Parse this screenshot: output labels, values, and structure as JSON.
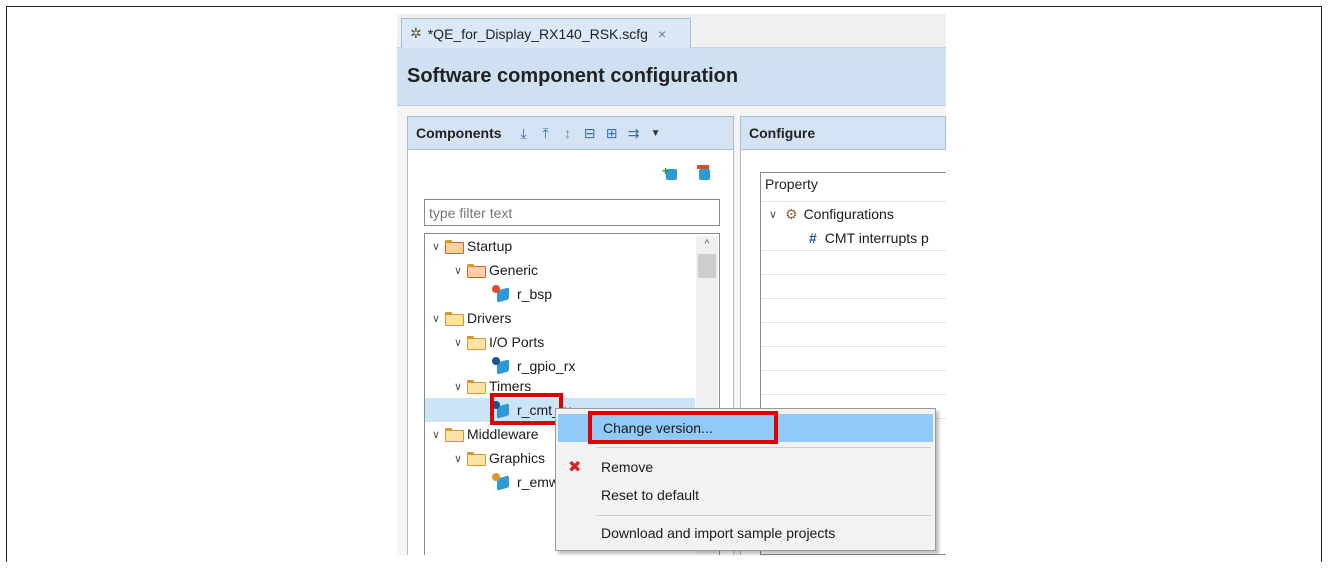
{
  "tab": {
    "title": "*QE_for_Display_RX140_RSK.scfg",
    "close": "×"
  },
  "editor": {
    "title": "Software component configuration"
  },
  "components_panel": {
    "title": "Components",
    "filter_placeholder": "type filter text",
    "tree": [
      {
        "label": "Startup"
      },
      {
        "label": "Generic"
      },
      {
        "label": "r_bsp"
      },
      {
        "label": "Drivers"
      },
      {
        "label": "I/O Ports"
      },
      {
        "label": "r_gpio_rx"
      },
      {
        "label": "Timers"
      },
      {
        "label": "r_cmt_rx"
      },
      {
        "label": "Middleware"
      },
      {
        "label": "Graphics"
      },
      {
        "label": "r_emwin"
      }
    ]
  },
  "configure_panel": {
    "title": "Configure",
    "property_header": "Property",
    "rows": [
      {
        "label": "Configurations"
      },
      {
        "label": "CMT interrupts p"
      }
    ]
  },
  "context_menu": {
    "items": [
      {
        "label": "Change version..."
      },
      {
        "label": "Remove"
      },
      {
        "label": "Reset to default"
      },
      {
        "label": "Download and import sample projects"
      }
    ]
  },
  "colors": {
    "highlight": "#e10000",
    "selection": "#91c9f7"
  }
}
